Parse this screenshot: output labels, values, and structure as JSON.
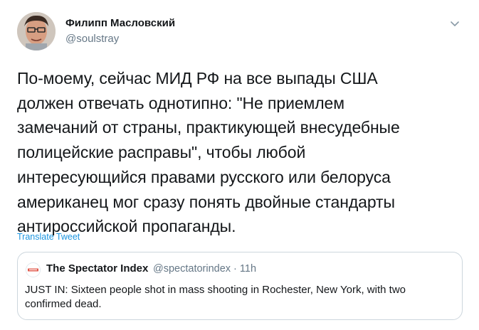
{
  "tweet": {
    "author": {
      "display_name": "Филипп Масловский",
      "handle": "@soulstray"
    },
    "body_lines": [
      "По-моему, сейчас МИД РФ на все выпады США",
      "должен отвечать однотипно: \"Не приемлем",
      "замечаний от страны, практикующей внесудебные",
      "полицейские расправы\", чтобы любой",
      "интересующийся правами русского или белоруса",
      "американец мог сразу понять двойные стандарты",
      "антироссийской пропаганды."
    ],
    "translate_label": "Translate Tweet",
    "menu_icon": "chevron-down-icon"
  },
  "quoted_tweet": {
    "display_name": "The Spectator Index",
    "meta": "@spectatorindex · 11h",
    "text_lines": [
      "JUST IN: Sixteen people shot in mass shooting in Rochester, New York, with two",
      "confirmed dead."
    ]
  },
  "colors": {
    "text": "#14171a",
    "secondary": "#657786",
    "link": "#1b95e0",
    "border": "#ccd6dd"
  }
}
